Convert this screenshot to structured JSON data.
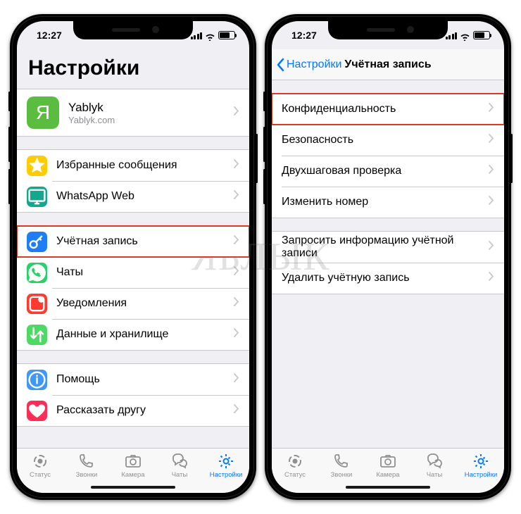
{
  "status": {
    "time": "12:27"
  },
  "left": {
    "large_title": "Настройки",
    "profile": {
      "avatar_letter": "Я",
      "name": "Yablyk",
      "sub": "Yablyk.com"
    },
    "group2": [
      {
        "label": "Избранные сообщения",
        "ic": "star",
        "bg": "#ffcc00"
      },
      {
        "label": "WhatsApp Web",
        "ic": "monitor",
        "bg": "#13a88e"
      }
    ],
    "group3": [
      {
        "label": "Учётная запись",
        "ic": "key",
        "bg": "#1f7ef5",
        "hl": true
      },
      {
        "label": "Чаты",
        "ic": "whatsapp",
        "bg": "#25d366"
      },
      {
        "label": "Уведомления",
        "ic": "notif",
        "bg": "#ff3b30"
      },
      {
        "label": "Данные и хранилище",
        "ic": "arrows",
        "bg": "#4cd964"
      }
    ],
    "group4": [
      {
        "label": "Помощь",
        "ic": "info",
        "bg": "#3f97f6"
      },
      {
        "label": "Рассказать другу",
        "ic": "heart",
        "bg": "#ff2d55"
      }
    ]
  },
  "right": {
    "back": "Настройки",
    "title": "Учётная запись",
    "group1": [
      {
        "label": "Конфиденциальность",
        "hl": true
      },
      {
        "label": "Безопасность"
      },
      {
        "label": "Двухшаговая проверка"
      },
      {
        "label": "Изменить номер"
      }
    ],
    "group2": [
      {
        "label": "Запросить информацию учётной записи"
      },
      {
        "label": "Удалить учётную запись"
      }
    ]
  },
  "tabs": [
    {
      "label": "Статус",
      "ic": "status"
    },
    {
      "label": "Звонки",
      "ic": "phone"
    },
    {
      "label": "Камера",
      "ic": "camera"
    },
    {
      "label": "Чаты",
      "ic": "chats"
    },
    {
      "label": "Настройки",
      "ic": "gear",
      "active": true
    }
  ],
  "watermark": "ЯБЛЫК"
}
